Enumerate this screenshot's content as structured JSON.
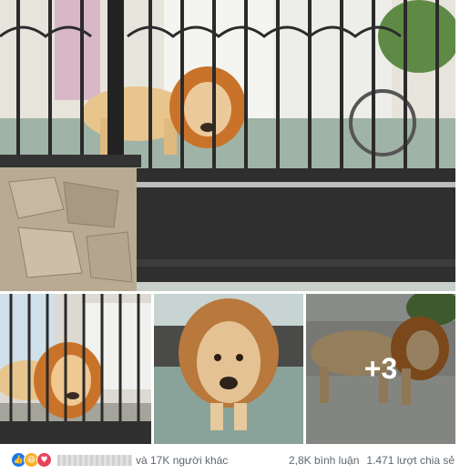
{
  "colors": {
    "like": "#1877f2",
    "haha": "#f7b125",
    "love": "#e8425a",
    "meta_text": "#606770"
  },
  "reactions": {
    "icons": [
      "like-icon",
      "haha-icon",
      "love-icon"
    ],
    "others_text": "và 17K người khác"
  },
  "stats": {
    "comments": "2,8K bình luận",
    "shares": "1.471 lượt chia sẻ"
  },
  "photos": {
    "more_count": "+3"
  }
}
